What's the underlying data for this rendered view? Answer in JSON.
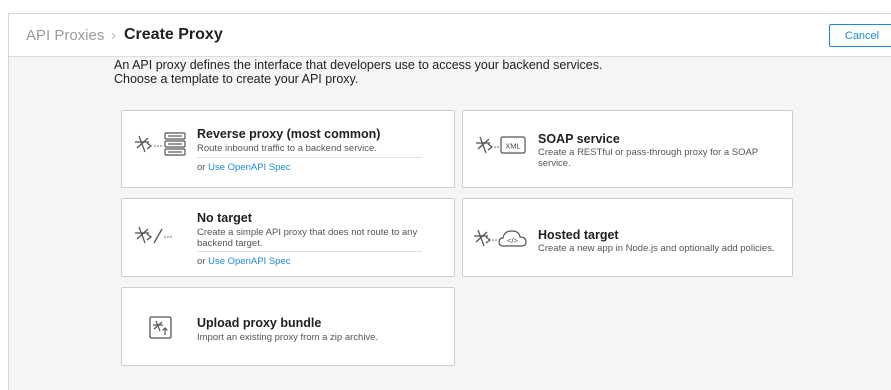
{
  "breadcrumb": {
    "root": "API Proxies",
    "separator": "›",
    "current": "Create Proxy"
  },
  "header": {
    "cancel_label": "Cancel"
  },
  "intro": {
    "line1": "An API proxy defines the interface that developers use to access your backend services.",
    "line2": "Choose a template to create your API proxy."
  },
  "cards": {
    "reverse": {
      "title": "Reverse proxy (most common)",
      "desc": "Route inbound traffic to a backend service.",
      "alt_prefix": "or ",
      "alt_link": "Use OpenAPI Spec"
    },
    "soap": {
      "title": "SOAP service",
      "desc": "Create a RESTful or pass-through proxy for a SOAP service.",
      "icon_text": "XML"
    },
    "notarget": {
      "title": "No target",
      "desc": "Create a simple API proxy that does not route to any backend target.",
      "alt_prefix": "or ",
      "alt_link": "Use OpenAPI Spec"
    },
    "hosted": {
      "title": "Hosted target",
      "desc": "Create a new app in Node.js and optionally add policies.",
      "icon_text": "</>"
    },
    "upload": {
      "title": "Upload proxy bundle",
      "desc": "Import an existing proxy from a zip archive."
    }
  },
  "colors": {
    "accent": "#1b8bd6",
    "page_bg": "#f5f5f5",
    "card_border": "#cfcfcf"
  },
  "icons": [
    "proxy-arrow-icon",
    "server-stack-icon",
    "xml-document-icon",
    "no-target-slash-icon",
    "cloud-code-icon",
    "upload-bundle-icon"
  ]
}
